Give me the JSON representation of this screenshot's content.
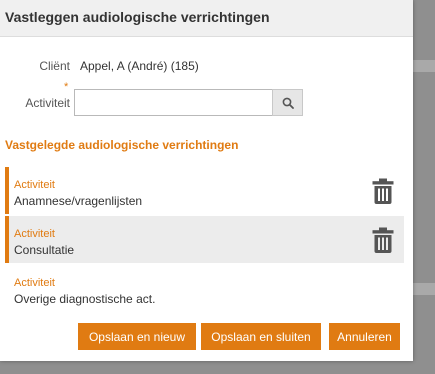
{
  "dialog": {
    "title": "Vastleggen audiologische verrichtingen",
    "client_label": "Cliënt",
    "client_value": "Appel, A (André) (185)",
    "activity_label": "Activiteit",
    "required_marker": "*",
    "activity_value": "",
    "section_title": "Vastgelegde audiologische verrichtingen",
    "items": [
      {
        "label": "Activiteit",
        "value": "Anamnese/vragenlijsten"
      },
      {
        "label": "Activiteit",
        "value": "Consultatie"
      },
      {
        "label": "Activiteit",
        "value": "Overige diagnostische act."
      }
    ],
    "buttons": {
      "save_new": "Opslaan en nieuw",
      "save_close": "Opslaan en sluiten",
      "cancel": "Annuleren"
    }
  },
  "colors": {
    "accent": "#e07b12",
    "title_bar": "#f0f0f0",
    "selected_row": "#ececec",
    "icon": "#555555"
  },
  "icons": {
    "search": "search-icon",
    "delete": "trash-icon"
  }
}
